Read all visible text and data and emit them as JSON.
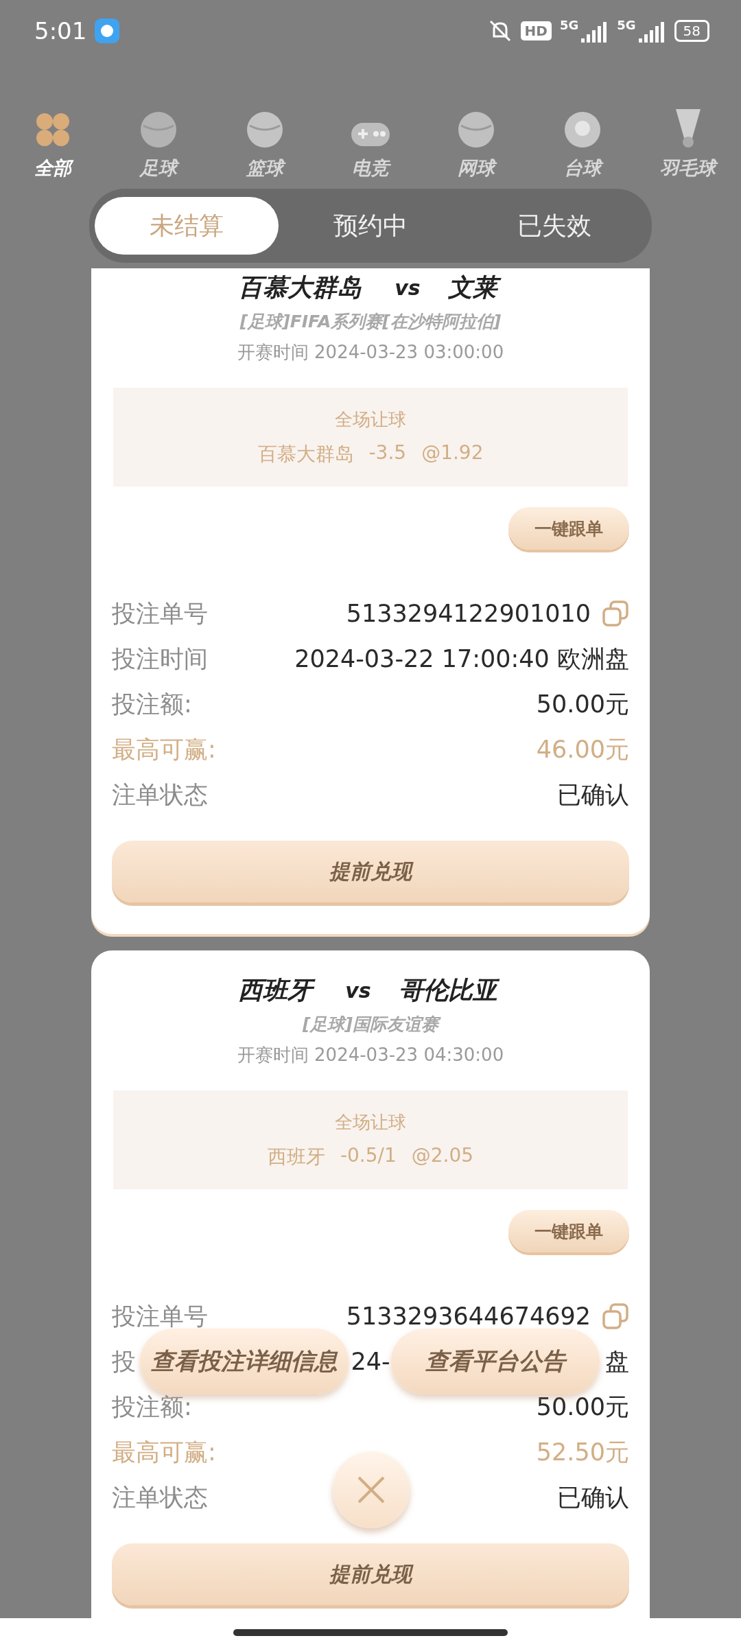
{
  "status_bar": {
    "time": "5:01",
    "hd": "HD",
    "networks": [
      "5G",
      "5G"
    ],
    "battery": "58"
  },
  "categories": [
    {
      "label": "全部",
      "selected": true
    },
    {
      "label": "足球",
      "selected": false
    },
    {
      "label": "篮球",
      "selected": false
    },
    {
      "label": "电竞",
      "selected": false
    },
    {
      "label": "网球",
      "selected": false
    },
    {
      "label": "台球",
      "selected": false
    },
    {
      "label": "羽毛球",
      "selected": false
    }
  ],
  "tabs": [
    {
      "label": "未结算",
      "selected": true
    },
    {
      "label": "预约中",
      "selected": false
    },
    {
      "label": "已失效",
      "selected": false
    }
  ],
  "bets": [
    {
      "home": "百慕大群岛",
      "vs": "vs",
      "away": "文莱",
      "league": "[足球]FIFA系列赛[在沙特阿拉伯]",
      "start_time": "开赛时间 2024-03-23 03:00:00",
      "market": "全场让球",
      "selection": {
        "team": "百慕大群岛",
        "line": "-3.5",
        "odds": "@1.92"
      },
      "follow_button": "一键跟单",
      "rows": [
        {
          "kind": "copy",
          "label": "投注单号",
          "value": "5133294122901010"
        },
        {
          "kind": "plain",
          "label": "投注时间",
          "value": "2024-03-22 17:00:40 欧洲盘"
        },
        {
          "kind": "plain",
          "label": "投注额:",
          "value": "50.00元"
        },
        {
          "kind": "highlight",
          "label": "最高可赢:",
          "value": "46.00元"
        },
        {
          "kind": "plain",
          "label": "注单状态",
          "value": "已确认"
        }
      ],
      "cashout_button": "提前兑现"
    },
    {
      "home": "西班牙",
      "vs": "vs",
      "away": "哥伦比亚",
      "league": "[足球]国际友谊赛",
      "start_time": "开赛时间 2024-03-23 04:30:00",
      "market": "全场让球",
      "selection": {
        "team": "西班牙",
        "line": "-0.5/1",
        "odds": "@2.05"
      },
      "follow_button": "一键跟单",
      "rows": [
        {
          "kind": "copy",
          "label": "投注单号",
          "value": "5133293644674692"
        },
        {
          "kind": "covered",
          "label": "投",
          "value": "24-",
          "tail": "盘"
        },
        {
          "kind": "plain",
          "label": "投注额:",
          "value": "50.00元"
        },
        {
          "kind": "highlight",
          "label": "最高可赢:",
          "value": "52.50元"
        },
        {
          "kind": "plain",
          "label": "注单状态",
          "value": "已确认"
        }
      ],
      "cashout_button": "提前兑现"
    }
  ],
  "overlay": {
    "buttons": [
      "查看投注详细信息",
      "查看平台公告"
    ]
  }
}
